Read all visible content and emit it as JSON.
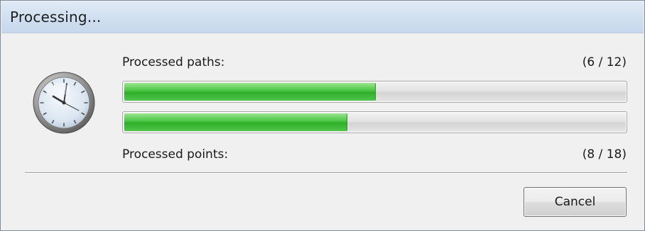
{
  "window": {
    "title": "Processing..."
  },
  "icons": {
    "clock": "clock-icon"
  },
  "paths": {
    "label": "Processed paths:",
    "count": "(6 / 12)",
    "progress_fraction": 0.5
  },
  "points": {
    "label": "Processed points:",
    "count": "(8 / 18)",
    "progress_fraction": 0.4444
  },
  "buttons": {
    "cancel_label": "Cancel"
  },
  "colors": {
    "progress_fill": "#3cba36",
    "title_bar": "#d3e2f2"
  }
}
